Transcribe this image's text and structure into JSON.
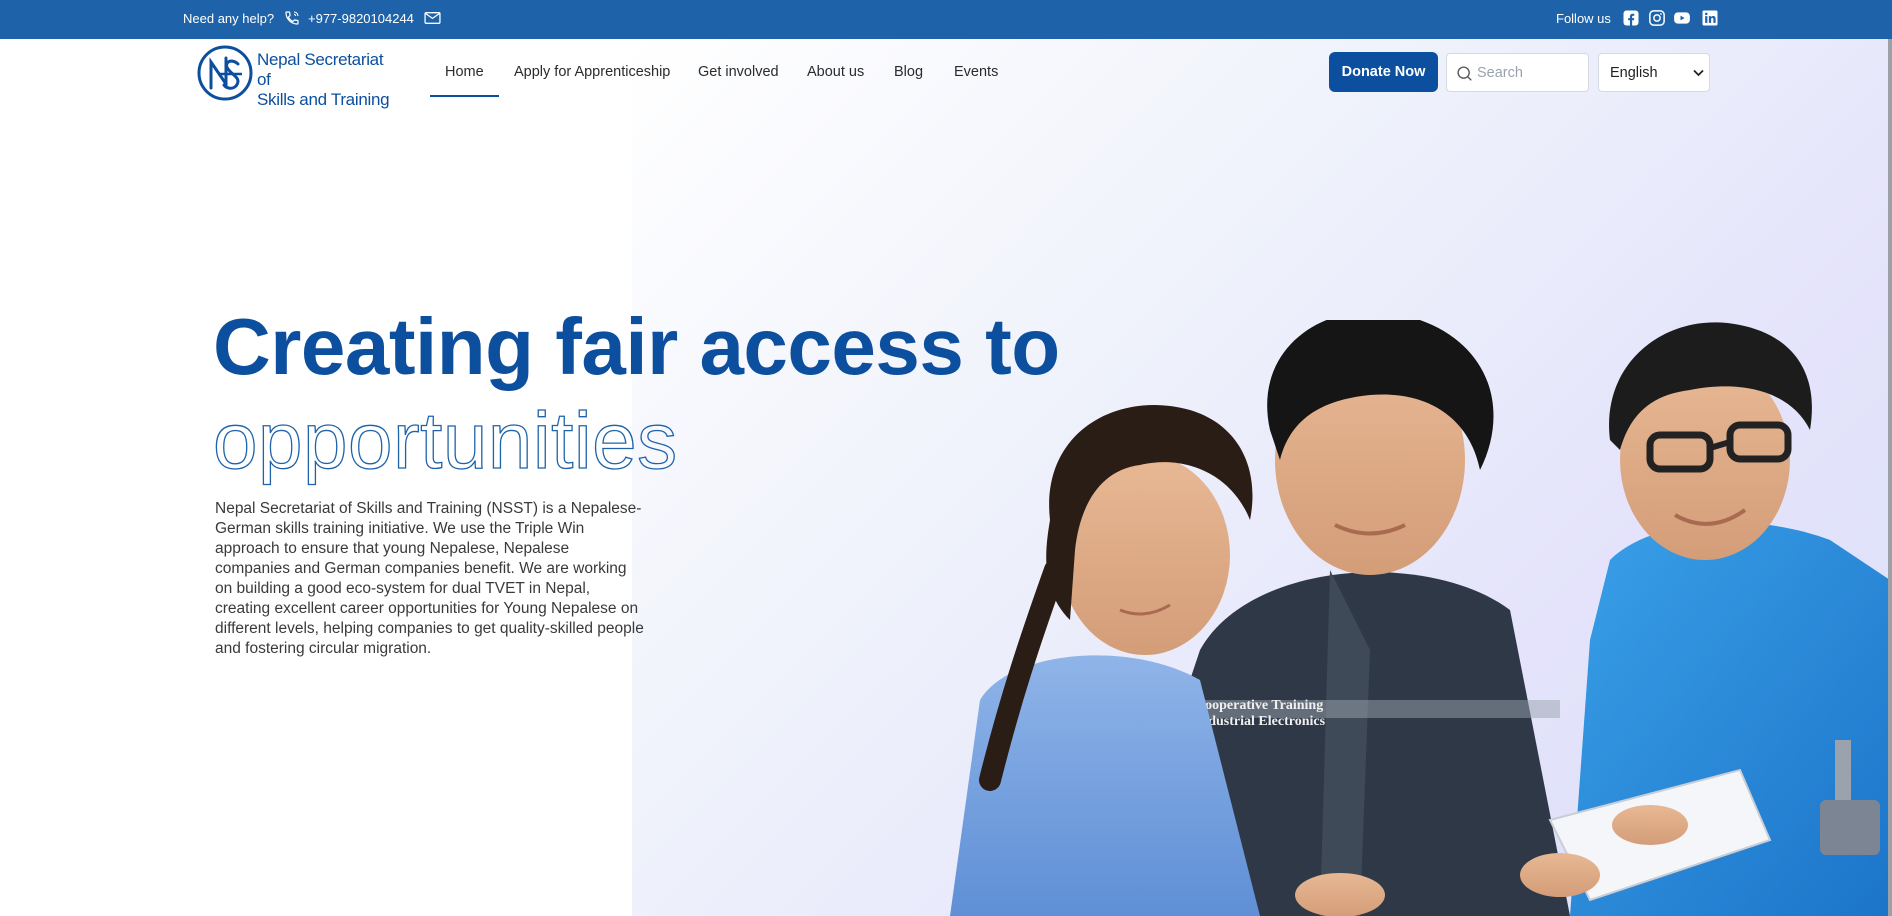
{
  "topbar": {
    "help_text": "Need any help?",
    "phone": "+977-9820104244",
    "follow_text": "Follow us",
    "icons": [
      "phone-icon",
      "mail-icon",
      "facebook-icon",
      "instagram-icon",
      "youtube-icon",
      "linkedin-icon"
    ]
  },
  "brand": {
    "name_line1": "Nepal Secretariat of",
    "name_line2": "Skills and Training",
    "color": "#0b4f9e"
  },
  "nav": {
    "items": [
      {
        "label": "Home",
        "active": true
      },
      {
        "label": "Apply for Apprenticeship"
      },
      {
        "label": "Get involved"
      },
      {
        "label": "About us"
      },
      {
        "label": "Blog"
      },
      {
        "label": "Events"
      }
    ]
  },
  "actions": {
    "donate_label": "Donate Now",
    "search_placeholder": "Search",
    "language_selected": "English"
  },
  "hero": {
    "headline": "Creating fair access to",
    "headline_outline": "opportunities",
    "description": "Nepal Secretariat of Skills and Training (NSST) is a Nepalese-German skills training initiative. We use the Triple Win approach to ensure that young Nepalese, Nepalese companies and German companies benefit. We are working on building a good eco-system for dual TVET in Nepal, creating excellent career opportunities for Young Nepalese on different levels, helping companies to get quality-skilled people and fostering circular migration.",
    "jacket_print_line1": "Cooperative Training",
    "jacket_print_line2": "Industrial Electronics"
  },
  "colors": {
    "topbar": "#1e63aa",
    "primary": "#0b4f9e",
    "hero_gradient": "#e4e3fb"
  }
}
